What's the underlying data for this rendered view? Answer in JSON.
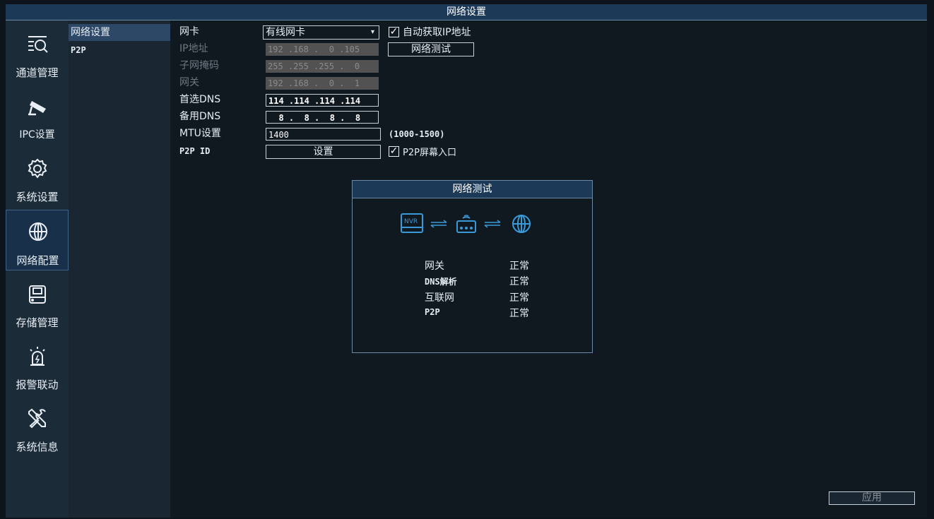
{
  "window": {
    "title": "网络设置"
  },
  "sidebar": {
    "items": [
      {
        "label": "通道管理",
        "icon": "channel-search-icon"
      },
      {
        "label": "IPC设置",
        "icon": "camera-icon"
      },
      {
        "label": "系统设置",
        "icon": "gear-icon"
      },
      {
        "label": "网络配置",
        "icon": "globe-icon",
        "active": true
      },
      {
        "label": "存储管理",
        "icon": "hard-drive-icon"
      },
      {
        "label": "报警联动",
        "icon": "alarm-icon"
      },
      {
        "label": "系统信息",
        "icon": "tools-icon"
      }
    ]
  },
  "subnav": {
    "items": [
      {
        "label": "网络设置",
        "active": true
      },
      {
        "label": "P2P"
      }
    ]
  },
  "form": {
    "nic": {
      "label": "网卡",
      "value": "有线网卡"
    },
    "auto_ip": {
      "label": "自动获取IP地址",
      "checked": true
    },
    "ip": {
      "label": "IP地址",
      "value": "192 .168 .  0 .105"
    },
    "net_test_button": "网络测试",
    "mask": {
      "label": "子网掩码",
      "value": "255 .255 .255 .  0"
    },
    "gateway": {
      "label": "网关",
      "value": "192 .168 .  0 .  1"
    },
    "dns1": {
      "label": "首选DNS",
      "value": "114 .114 .114 .114"
    },
    "dns2": {
      "label": "备用DNS",
      "value": "  8 .  8 .  8 .  8"
    },
    "mtu": {
      "label": "MTU设置",
      "value": "1400",
      "range": "(1000-1500)"
    },
    "p2p_id": {
      "label": "P2P ID",
      "button": "设置"
    },
    "p2p_screen": {
      "label": "P2P屏幕入口",
      "checked": true
    }
  },
  "dialog": {
    "title": "网络测试",
    "diagram": {
      "nvr_label": "NVR"
    },
    "results": [
      {
        "name": "网关",
        "status": "正常"
      },
      {
        "name": "DNS解析",
        "status": "正常"
      },
      {
        "name": "互联网",
        "status": "正常"
      },
      {
        "name": "P2P",
        "status": "正常"
      }
    ]
  },
  "footer": {
    "apply_button": "应用"
  },
  "colors": {
    "accent": "#1c3a58",
    "icon_blue": "#3a9ad9",
    "background": "#101820"
  }
}
